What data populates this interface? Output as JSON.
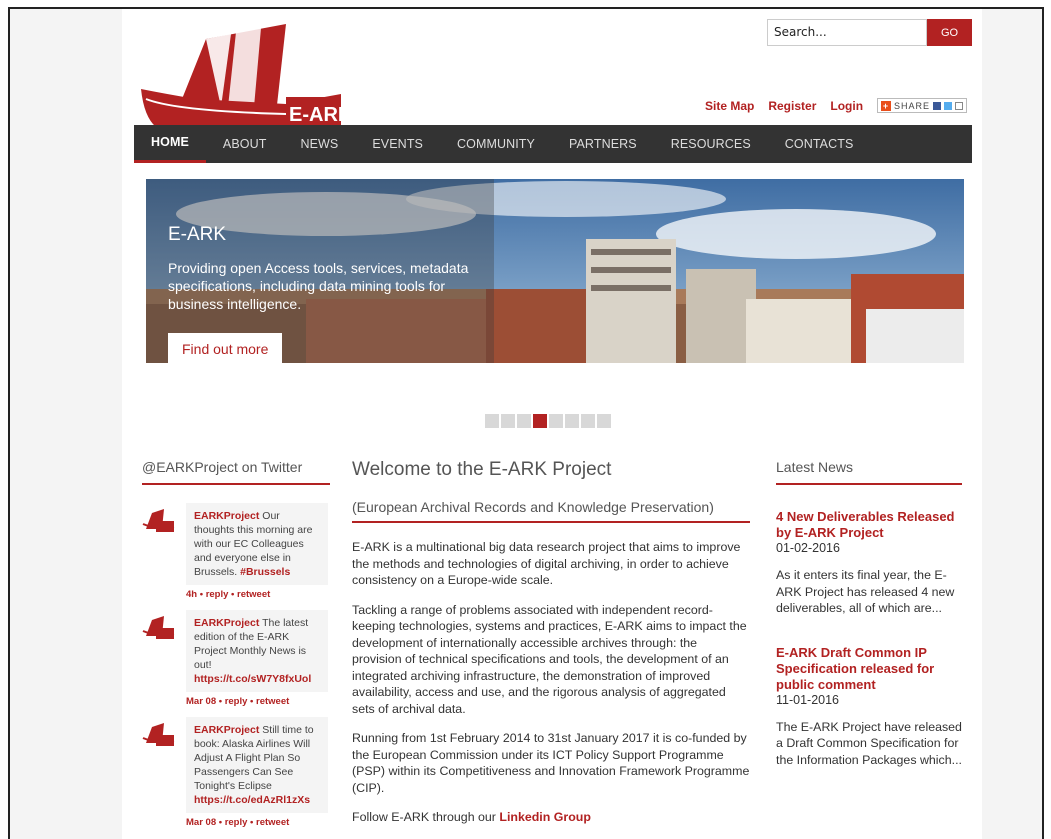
{
  "header": {
    "logo_text": "E-ARK",
    "search_placeholder": "Search...",
    "search_button": "GO",
    "links": [
      "Site Map",
      "Register",
      "Login"
    ],
    "share_label": "SHARE"
  },
  "nav": {
    "items": [
      {
        "label": "HOME",
        "active": true
      },
      {
        "label": "ABOUT"
      },
      {
        "label": "NEWS"
      },
      {
        "label": "EVENTS"
      },
      {
        "label": "COMMUNITY"
      },
      {
        "label": "PARTNERS"
      },
      {
        "label": "RESOURCES"
      },
      {
        "label": "CONTACTS"
      }
    ]
  },
  "hero": {
    "title": "E-ARK",
    "text": "Providing open Access tools, services, metadata specifications, including data mining tools for business intelligence.",
    "button": "Find out more",
    "slides": 8,
    "active_slide": 4
  },
  "twitter": {
    "heading": "@EARKProject on Twitter",
    "tweets": [
      {
        "user": "EARKProject",
        "text": " Our thoughts this morning are with our EC Colleagues and everyone else in Brussels. ",
        "link": "#Brussels",
        "meta": "4h • reply • retweet"
      },
      {
        "user": "EARKProject",
        "text": " The latest edition of the E-ARK Project Monthly News is out! ",
        "link": "https://t.co/sW7Y8fxUol",
        "meta": "Mar 08 • reply • retweet"
      },
      {
        "user": "EARKProject",
        "text": " Still time to book: Alaska Airlines Will Adjust A Flight Plan So Passengers Can See Tonight's Eclipse ",
        "link": "https://t.co/edAzRl1zXs",
        "meta": "Mar 08 • reply • retweet"
      }
    ]
  },
  "welcome": {
    "title": "Welcome to the E-ARK Project",
    "subtitle": "(European Archival Records and Knowledge Preservation)",
    "p1": "E-ARK is a multinational big data research project that aims to improve the methods and technologies of digital archiving, in order to achieve consistency on a Europe-wide scale.",
    "p2": "Tackling a range of problems associated with independent record-keeping technologies, systems and practices, E-ARK aims to impact the development of internationally accessible archives through: the provision of technical specifications and tools, the development of an integrated archiving infrastructure, the demonstration of improved availability, access and use, and the rigorous analysis of aggregated sets of archival data.",
    "p3": "Running from 1st February 2014 to 31st January 2017 it is co-funded by the European Commission under its ICT Policy Support Programme (PSP) within its Competitiveness and Innovation Framework Programme (CIP).",
    "follow_text": "Follow E-ARK through our ",
    "follow_link": "Linkedin Group"
  },
  "news": {
    "heading": "Latest News",
    "items": [
      {
        "title": "4 New Deliverables Released by E-ARK Project",
        "date": "01-02-2016",
        "body": "As it enters its final year, the E-ARK Project has released 4 new deliverables, all of which are..."
      },
      {
        "title": "E-ARK Draft Common IP Specification released for public comment",
        "date": "11-01-2016",
        "body": "The E-ARK Project have released a Draft Common Specification for the Information Packages which..."
      }
    ]
  },
  "colors": {
    "accent": "#b22222",
    "nav_bg": "#333333"
  }
}
